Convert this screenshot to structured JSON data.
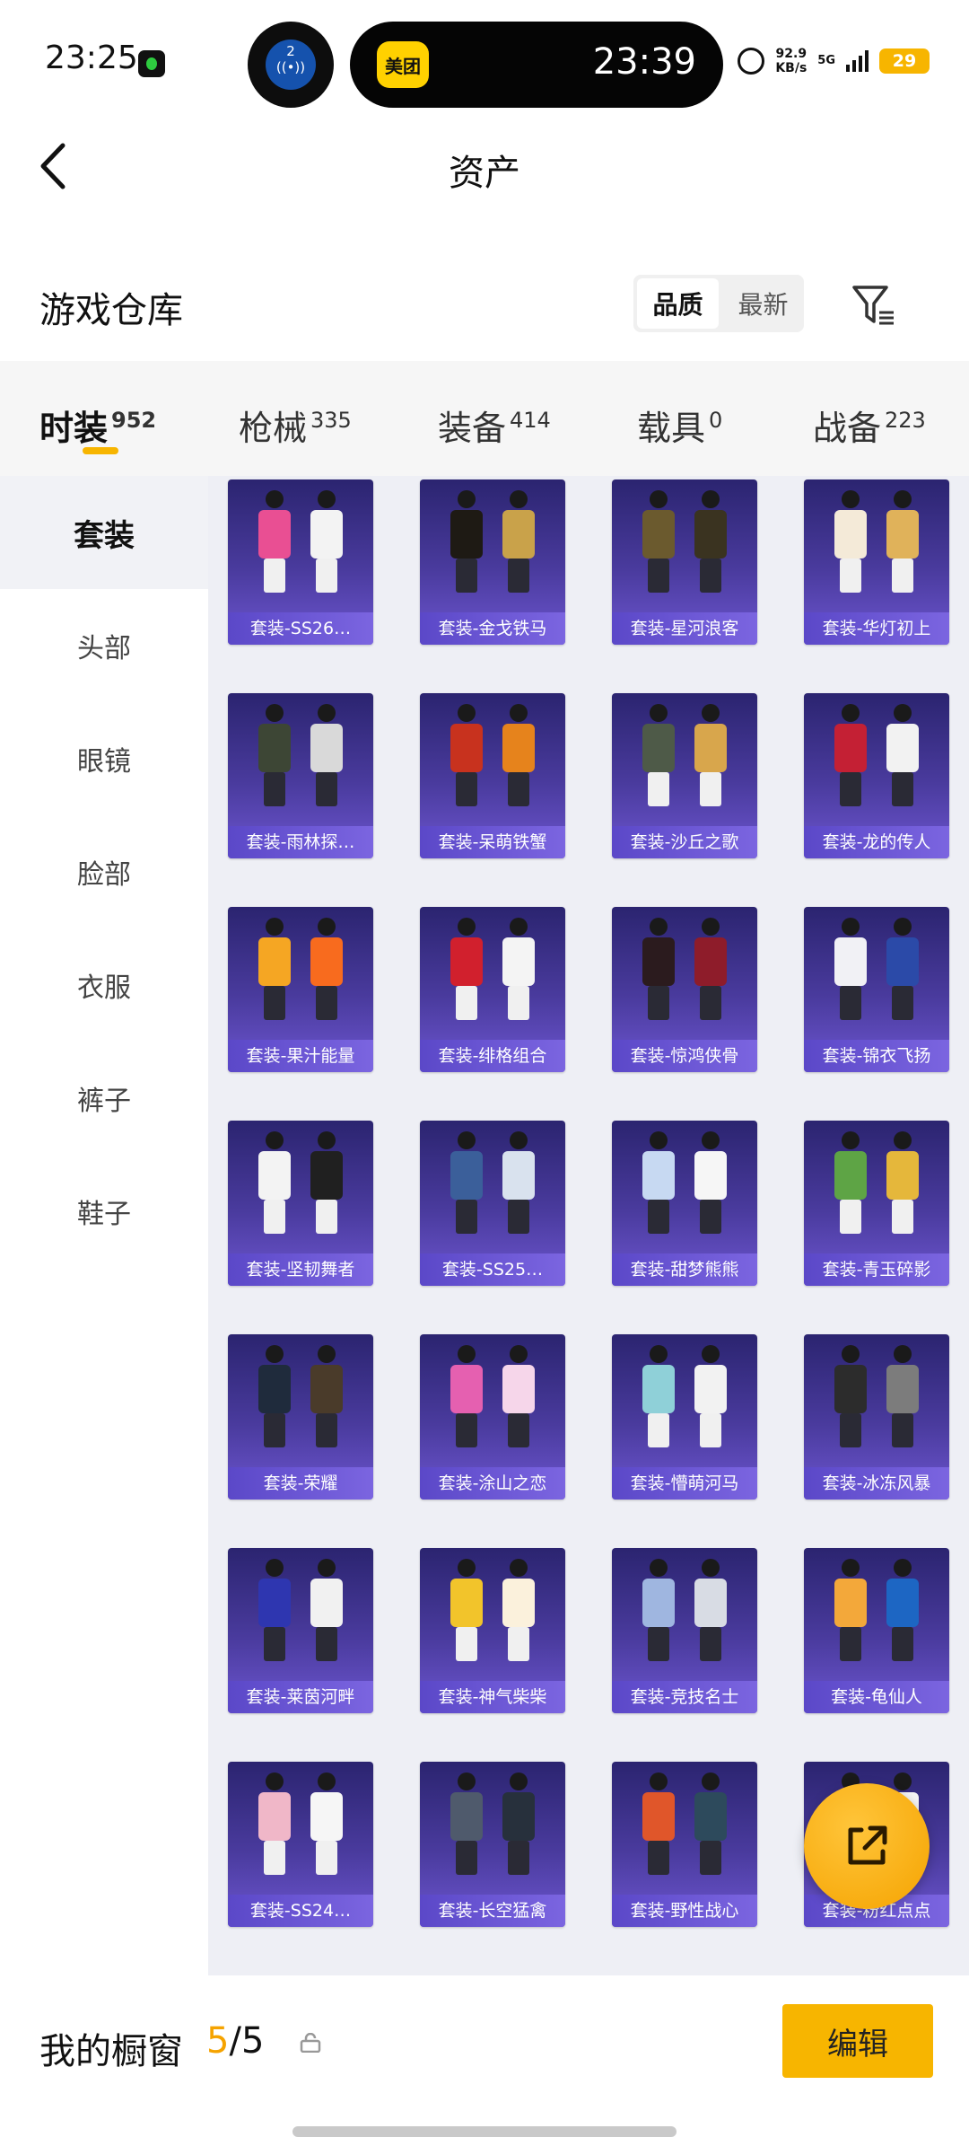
{
  "status_bar": {
    "time": "23:25",
    "badge_number": "2",
    "pill_app": "美团",
    "pill_time": "23:39",
    "net_speed_value": "92.9",
    "net_speed_unit": "KB/s",
    "network": "5G",
    "battery": "29"
  },
  "header": {
    "title": "资产"
  },
  "warehouse": {
    "title": "游戏仓库",
    "sort_options": [
      "品质",
      "最新"
    ],
    "sort_selected": "品质"
  },
  "category_tabs": [
    {
      "label": "时装",
      "count": "952",
      "active": true
    },
    {
      "label": "枪械",
      "count": "335"
    },
    {
      "label": "装备",
      "count": "414"
    },
    {
      "label": "载具",
      "count": "0"
    },
    {
      "label": "战备",
      "count": "223"
    }
  ],
  "side_nav": [
    "套装",
    "头部",
    "眼镜",
    "脸部",
    "衣服",
    "裤子",
    "鞋子"
  ],
  "items": [
    "套装-SS26…",
    "套装-金戈铁马",
    "套装-星河浪客",
    "套装-华灯初上",
    "套装-雨林探…",
    "套装-呆萌铁蟹",
    "套装-沙丘之歌",
    "套装-龙的传人",
    "套装-果汁能量",
    "套装-绯格组合",
    "套装-惊鸿侠骨",
    "套装-锦衣飞扬",
    "套装-坚韧舞者",
    "套装-SS25…",
    "套装-甜梦熊熊",
    "套装-青玉碎影",
    "套装-荣耀",
    "套装-涂山之恋",
    "套装-懵萌河马",
    "套装-冰冻风暴",
    "套装-莱茵河畔",
    "套装-神气柴柴",
    "套装-竞技名士",
    "套装-龟仙人",
    "套装-SS24…",
    "套装-长空猛禽",
    "套装-野性战心",
    "套装-粉红点点"
  ],
  "item_colors": [
    [
      "#e94f93",
      "#f3f3f3"
    ],
    [
      "#1e1a14",
      "#c9a24a"
    ],
    [
      "#6b5a2e",
      "#3a3320"
    ],
    [
      "#f4ead8",
      "#e0b25a"
    ],
    [
      "#3d4635",
      "#d9d9d9"
    ],
    [
      "#c8321e",
      "#e6831c"
    ],
    [
      "#4e5a48",
      "#d8a64c"
    ],
    [
      "#c42034",
      "#f2f2f2"
    ],
    [
      "#f5a623",
      "#f86b1e"
    ],
    [
      "#d1202d",
      "#f4f4f4"
    ],
    [
      "#2b1b1e",
      "#8e1c2a"
    ],
    [
      "#f1f1f5",
      "#2b4aa8"
    ],
    [
      "#f3f3f3",
      "#202020"
    ],
    [
      "#3b5f9a",
      "#d9e2ee"
    ],
    [
      "#c7d9f2",
      "#f6f6f6"
    ],
    [
      "#5ea445",
      "#e5b73b"
    ],
    [
      "#1f2b3c",
      "#4a3b2a"
    ],
    [
      "#e560b0",
      "#f6d6ea"
    ],
    [
      "#8fd0d8",
      "#f2f2f2"
    ],
    [
      "#2c2c2c",
      "#7c7c7c"
    ],
    [
      "#2e36b0",
      "#f1f1f1"
    ],
    [
      "#f2c42b",
      "#fbf1dc"
    ],
    [
      "#9fb6e0",
      "#d8dce4"
    ],
    [
      "#f3a83a",
      "#1d66c3"
    ],
    [
      "#f0b7c8",
      "#f6f6f6"
    ],
    [
      "#4f5a6c",
      "#27303c"
    ],
    [
      "#e0562a",
      "#2d4a5c"
    ],
    [
      "#f3a0c6",
      "#f4f4f4"
    ]
  ],
  "showcase": {
    "title": "我的橱窗",
    "current": "5",
    "separator": "/",
    "total": "5"
  },
  "edit_label": "编辑",
  "icons": {
    "back": "chevron-left-icon",
    "filter": "filter-icon",
    "share": "share-icon",
    "lock": "lock-icon"
  }
}
